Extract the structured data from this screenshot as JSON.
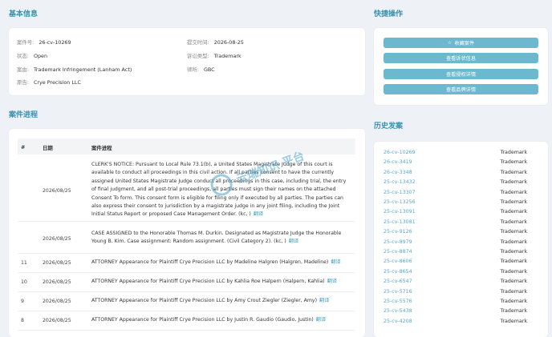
{
  "basic_info": {
    "section_title": "基本信息",
    "case_no_label": "案件号:",
    "case_no": "26-cv-10269",
    "filed_label": "提交时间:",
    "filed": "2026-08-25",
    "status_label": "状态:",
    "status": "Open",
    "type_label": "诉讼类型:",
    "type": "Trademark",
    "cause_label": "案由:",
    "cause": "Trademark Infringement (Lanham Act)",
    "firm_label": "律所:",
    "firm": "GBC",
    "plaintiff_label": "原告:",
    "plaintiff": "Crye Precision LLC"
  },
  "quick_actions": {
    "section_title": "快捷操作",
    "buttons": [
      "收藏案件",
      "查看诉状信息",
      "查看侵权详情",
      "查看品牌详情"
    ]
  },
  "docket": {
    "section_title": "案件进程",
    "headers": [
      "#",
      "日期",
      "案件进程"
    ],
    "detail_link": "翻译",
    "rows": [
      {
        "num": "",
        "date": "2026/08/25",
        "text": "CLERK'S NOTICE: Pursuant to Local Rule 73.1(b), a United States Magistrate Judge of this court is available to conduct all proceedings in this civil action. If all parties consent to have the currently assigned United States Magistrate Judge conduct all proceedings in this case, including trial, the entry of final judgment, and all post-trial proceedings, all parties must sign their names on the attached Consent To form. This consent form is eligible for filing only if executed by all parties. The parties can also express their consent to jurisdiction by a magistrate judge in any joint filing, including the Joint Initial Status Report or proposed Case Management Order. (kc, )"
      },
      {
        "num": "",
        "date": "2026/08/25",
        "text": "CASE ASSIGNED to the Honorable Thomas M. Durkin. Designated as Magistrate Judge the Honorable Young B. Kim. Case assignment: Random assignment. (Civil Category 2). (kc, )"
      },
      {
        "num": "11",
        "date": "2026/08/25",
        "text": "ATTORNEY Appearance for Plaintiff Crye Precision LLC by Madeline Halgren (Halgren, Madeline)"
      },
      {
        "num": "10",
        "date": "2026/08/25",
        "text": "ATTORNEY Appearance for Plaintiff Crye Precision LLC by Kahlia Roe Halpern (Halpern, Kahlia)"
      },
      {
        "num": "9",
        "date": "2026/08/25",
        "text": "ATTORNEY Appearance for Plaintiff Crye Precision LLC by Amy Crout Ziegler (Ziegler, Amy)"
      },
      {
        "num": "8",
        "date": "2026/08/25",
        "text": "ATTORNEY Appearance for Plaintiff Crye Precision LLC by Justin R. Gaudio (Gaudio, Justin)"
      }
    ]
  },
  "history": {
    "section_title": "历史发案",
    "cases": [
      {
        "case": "26-cv-10269",
        "type": "Trademark"
      },
      {
        "case": "26-cv-3419",
        "type": "Trademark"
      },
      {
        "case": "26-cv-3348",
        "type": "Trademark"
      },
      {
        "case": "25-cv-13432",
        "type": "Trademark"
      },
      {
        "case": "25-cv-13307",
        "type": "Trademark"
      },
      {
        "case": "25-cv-13256",
        "type": "Trademark"
      },
      {
        "case": "25-cv-13091",
        "type": "Trademark"
      },
      {
        "case": "25-cv-13081",
        "type": "Trademark"
      },
      {
        "case": "25-cv-9126",
        "type": "Trademark"
      },
      {
        "case": "25-cv-8979",
        "type": "Trademark"
      },
      {
        "case": "25-cv-8874",
        "type": "Trademark"
      },
      {
        "case": "25-cv-8606",
        "type": "Trademark"
      },
      {
        "case": "25-cv-8654",
        "type": "Trademark"
      },
      {
        "case": "25-cv-6547",
        "type": "Trademark"
      },
      {
        "case": "25-cv-5716",
        "type": "Trademark"
      },
      {
        "case": "25-cv-5576",
        "type": "Trademark"
      },
      {
        "case": "25-cv-5438",
        "type": "Trademark"
      },
      {
        "case": "25-cv-4208",
        "type": "Trademark"
      }
    ]
  },
  "watermark": {
    "text": "云瑞知识 平台",
    "color": "#4aa3c8"
  }
}
